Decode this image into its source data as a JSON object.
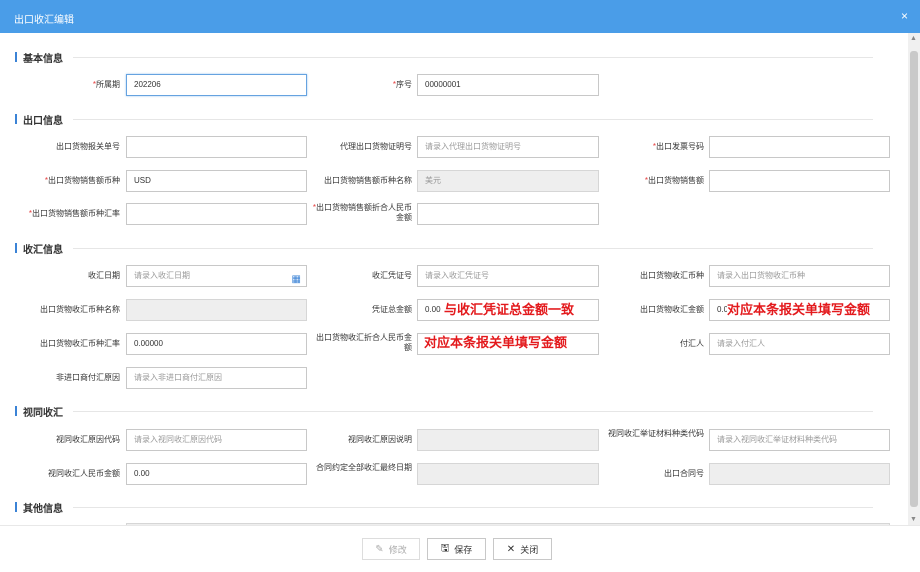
{
  "window": {
    "title": "出口收汇编辑",
    "close_icon": "×"
  },
  "sections": {
    "basic": "基本信息",
    "export": "出口信息",
    "receipt": "收汇信息",
    "deemed": "视同收汇",
    "other": "其他信息"
  },
  "basic": {
    "period_label": "所属期",
    "period_value": "202206",
    "seq_label": "序号",
    "seq_value": "00000001"
  },
  "export": {
    "decl_no_label": "出口货物报关单号",
    "decl_no_value": "",
    "agent_cert_label": "代理出口货物证明号",
    "agent_cert_ph": "请录入代理出口货物证明号",
    "invoice_label": "出口发票号码",
    "invoice_value": "",
    "currency_label": "出口货物销售额币种",
    "currency_value": "USD",
    "currency_name_label": "出口货物销售额币种名称",
    "currency_name_value": "美元",
    "sales_amount_label": "出口货物销售额",
    "sales_amount_value": "",
    "rate_label": "出口货物销售额币种汇率",
    "rate_value": "",
    "rmb_label": "出口货物销售额折合人民币金额",
    "rmb_value": ""
  },
  "receipt": {
    "date_label": "收汇日期",
    "date_ph": "请录入收汇日期",
    "voucher_label": "收汇凭证号",
    "voucher_ph": "请录入收汇凭证号",
    "cur_label": "出口货物收汇币种",
    "cur_ph": "请录入出口货物收汇币种",
    "cur_name_label": "出口货物收汇币种名称",
    "cur_name_value": "",
    "voucher_total_label": "凭证总金额",
    "voucher_total_value": "0.00",
    "amount_label": "出口货物收汇金额",
    "amount_value": "0.0",
    "rate_label": "出口货物收汇币种汇率",
    "rate_value": "0.00000",
    "rmb_label": "出口货物收汇折合人民币金额",
    "rmb_value": "0",
    "payer_label": "付汇人",
    "payer_ph": "请录入付汇人",
    "nonimport_label": "非进口商付汇原因",
    "nonimport_ph": "请录入非进口商付汇原因"
  },
  "deemed": {
    "code_label": "视同收汇原因代码",
    "code_ph": "请录入视同收汇原因代码",
    "desc_label": "视同收汇原因说明",
    "desc_value": "",
    "material_label": "视同收汇举证材料种类代码",
    "material_ph": "请录入视同收汇举证材料种类代码",
    "rmb_label": "视同收汇人民币金额",
    "rmb_value": "0.00",
    "deadline_label": "合同约定全部收汇最终日期",
    "deadline_value": "",
    "contract_label": "出口合同号",
    "contract_value": ""
  },
  "annotations": {
    "voucher_note": "与收汇凭证总金额一致",
    "amount_note": "对应本条报关单填写金额",
    "rmb_note": "对应本条报关单填写金额"
  },
  "footer": {
    "edit_label": "修改",
    "edit_icon": "✎",
    "save_label": "保存",
    "save_icon": "🖫",
    "close_label": "关闭",
    "close_icon": "✕"
  },
  "colors": {
    "titlebar": "#4a9de8",
    "accent": "#3b83d6",
    "required": "#e53c3c",
    "annotation": "#e3191c"
  }
}
